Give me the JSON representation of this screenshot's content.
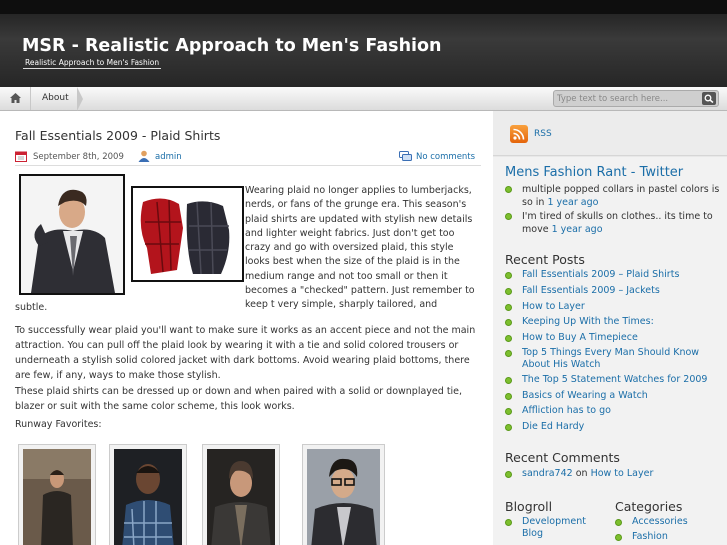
{
  "header": {
    "title": "MSR - Realistic Approach to Men's Fashion",
    "tagline": "Realistic Approach to Men's Fashion"
  },
  "nav": {
    "home_icon": "home-icon",
    "items": [
      {
        "label": "About"
      }
    ]
  },
  "search": {
    "placeholder": "Type text to search here...",
    "button_icon": "search-icon"
  },
  "post": {
    "title": "Fall Essentials 2009 - Plaid Shirts",
    "date": "September 8th, 2009",
    "author": "admin",
    "comments": "No comments",
    "intro": "Wearing plaid no longer applies to lumberjacks, nerds, or fans of the grunge era. This season's plaid shirts are updated with stylish new details and lighter weight fabrics. Just don't get too crazy and go with oversized plaid, this style looks best when the size of the plaid is in the medium range and not too small or then it becomes a \"checked\" pattern. Just remember to keep t very simple, sharply tailored, and",
    "intro_tail": "subtle.",
    "paragraph2": "To successfully wear plaid you'll want to make sure it works as an accent piece and not the main attraction. You can pull off the plaid look by wearing it with a tie and solid colored trousers or underneath a stylish solid colored jacket with dark bottoms. Avoid wearing plaid bottoms, there are few, if any, ways to make those stylish.",
    "paragraph3": "These plaid shirts can be dressed up or down and when paired with a solid or downplayed tie, blazer or suit with the same color scheme, this look works.",
    "runway_label": "Runway Favorites:"
  },
  "sidebar": {
    "rss_label": "RSS",
    "twitter": {
      "title": "Mens Fashion Rant - Twitter",
      "tweets": [
        {
          "text": "multiple popped collars in pastel colors is so in ",
          "time": "1 year ago"
        },
        {
          "text": "I'm tired of skulls on clothes.. its time to move ",
          "time": "1 year ago"
        }
      ]
    },
    "recent_posts": {
      "title": "Recent Posts",
      "items": [
        "Fall Essentials 2009 – Plaid Shirts",
        "Fall Essentials 2009 – Jackets",
        "How to Layer",
        "Keeping Up With the Times:",
        "How to Buy A Timepiece",
        "Top 5 Things Every Man Should Know About His Watch",
        "The Top 5 Statement Watches for 2009",
        "Basics of Wearing a Watch",
        "Affliction has to go",
        "Die Ed Hardy"
      ]
    },
    "recent_comments": {
      "title": "Recent Comments",
      "author": "sandra742",
      "on": " on ",
      "post": "How to Layer"
    },
    "blogroll": {
      "title": "Blogroll",
      "items": [
        "Development Blog"
      ]
    },
    "categories": {
      "title": "Categories",
      "items": [
        "Accessories",
        "Fashion"
      ]
    }
  },
  "colors": {
    "link": "#1b6ea8",
    "bullet": "#7dbf2e",
    "header_bg": "#2b2b2b"
  }
}
